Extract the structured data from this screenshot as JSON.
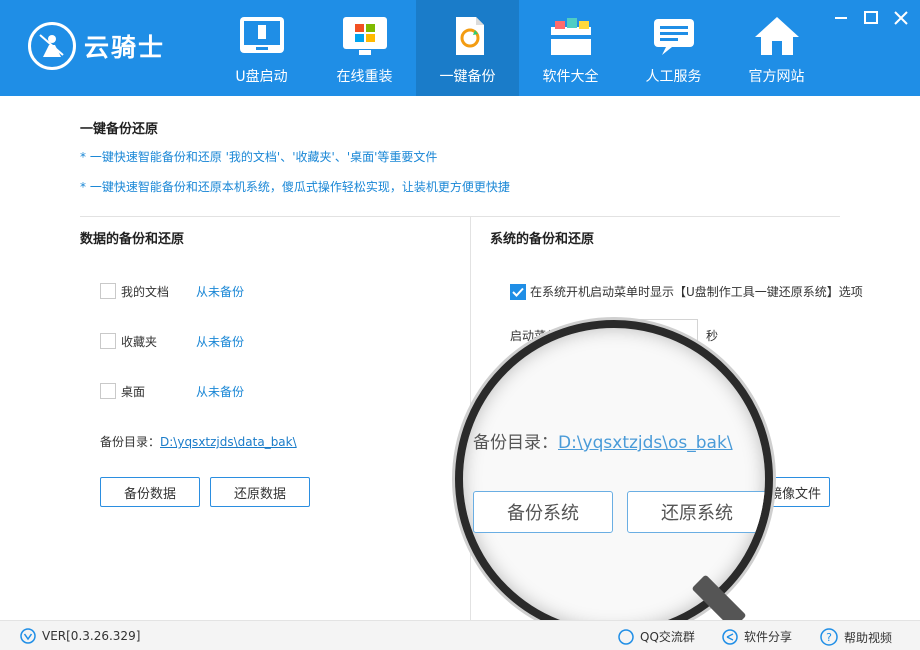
{
  "app": {
    "logo_text": "云骑士"
  },
  "nav": [
    {
      "label": "U盘启动",
      "icon": "usb-drive-icon"
    },
    {
      "label": "在线重装",
      "icon": "windows-icon"
    },
    {
      "label": "一键备份",
      "icon": "backup-refresh-icon",
      "active": true
    },
    {
      "label": "软件大全",
      "icon": "software-box-icon"
    },
    {
      "label": "人工服务",
      "icon": "chat-service-icon"
    },
    {
      "label": "官方网站",
      "icon": "home-icon"
    }
  ],
  "intro": {
    "title": "一键备份还原",
    "line1": "* 一键快速智能备份和还原 '我的文档'、'收藏夹'、'桌面'等重要文件",
    "line2": "* 一键快速智能备份和还原本机系统，傻瓜式操作轻松实现，让装机更方便更快捷"
  },
  "data_backup": {
    "title": "数据的备份和还原",
    "items": [
      {
        "label": "我的文档",
        "status": "从未备份"
      },
      {
        "label": "收藏夹",
        "status": "从未备份"
      },
      {
        "label": "桌面",
        "status": "从未备份"
      }
    ],
    "dir_label": "备份目录：",
    "dir_path": "D:\\yqsxtzjds\\data_bak\\",
    "backup_btn": "备份数据",
    "restore_btn": "还原数据"
  },
  "system_backup": {
    "title": "系统的备份和还原",
    "option_text": "在系统开机启动菜单时显示【U盘制作工具一键还原系统】选项",
    "delay_label": "启动菜单",
    "delay_unit": "秒",
    "dir_label": "备份目录：",
    "dir_path": "D:\\yqsxtzjds\\os_bak\\",
    "backup_btn": "备份系统",
    "restore_btn": "还原系统",
    "image_btn": "镜像文件"
  },
  "footer": {
    "version": "VER[0.3.26.329]",
    "qq_group": "QQ交流群",
    "share": "软件分享",
    "help": "帮助视频"
  },
  "colors": {
    "header": "#1f8ee6",
    "active_tab": "#1a7cc9",
    "link": "#1a87d6"
  }
}
